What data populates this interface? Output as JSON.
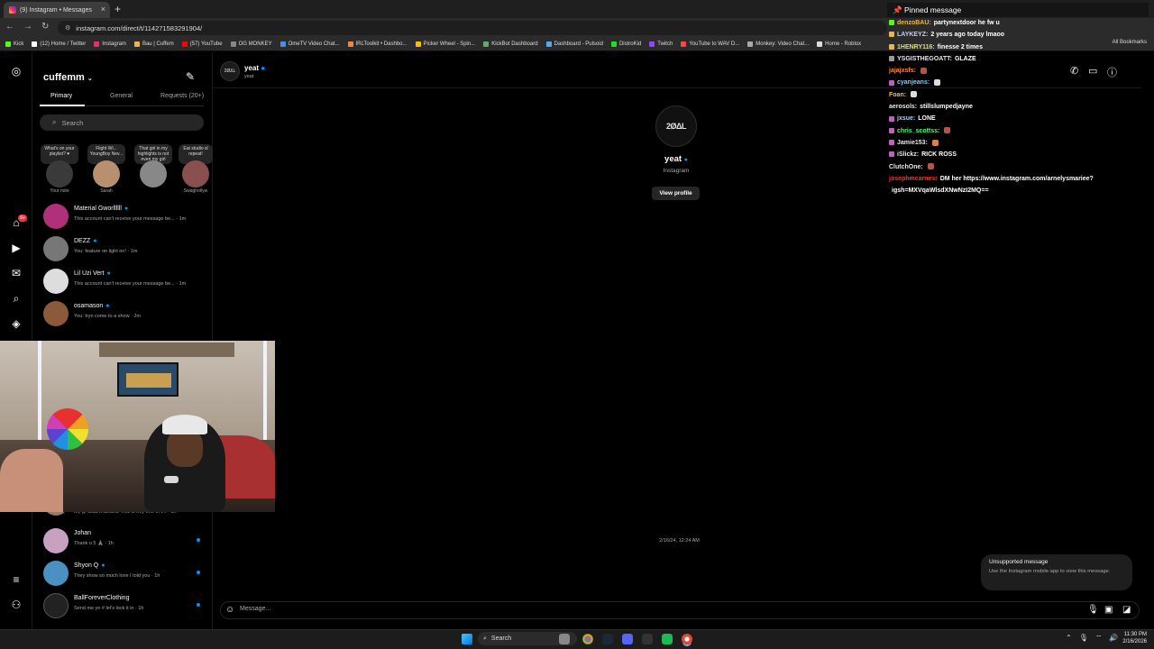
{
  "browser": {
    "tab_title": "(9) Instagram • Messages",
    "url": "instagram.com/direct/t/114271583291904/",
    "bookmarks": [
      "Kick",
      "(12) Home / Twitter",
      "Instagram",
      "Bau | Cuffem",
      "(57) YouTube",
      "OG MONKEY",
      "OmeTV Video Chat...",
      "IRLToolkit • Dashbo...",
      "Picker Wheel - Spin...",
      "KickBot Dashboard",
      "Dashboard - Pulsoid",
      "DistroKid",
      "Twitch",
      "YouTube to WAV D...",
      "Monkey: Video Chat...",
      "Home - Roblox"
    ],
    "all_bookmarks": "All Bookmarks"
  },
  "inbox": {
    "username": "cuffemm",
    "tabs": [
      "Primary",
      "General",
      "Requests (20+)"
    ],
    "search_placeholder": "Search",
    "notes": [
      {
        "bubble": "What's on your playlist? ♥",
        "name": "Your note"
      },
      {
        "bubble": "Flight Wi... YoungBoy Nev...",
        "name": "Sarah"
      },
      {
        "bubble": "That girl in my highlights is not even my girl",
        "name": ""
      },
      {
        "bubble": "Eat studio sl repeat!",
        "name": "Swaghollyw"
      }
    ],
    "conversations": [
      {
        "name": "Material Gworllllll",
        "verified": "●",
        "preview": "This account can't receive your message be... · 1m"
      },
      {
        "name": "DEZZ",
        "verified": "●",
        "preview": "You: feature on light on! · 1m"
      },
      {
        "name": "Lil Uzi Vert",
        "verified": "●",
        "preview": "This account can't receive your message be... · 1m"
      },
      {
        "name": "osamason",
        "verified": "●",
        "preview": "You: tryn come to a show · 2m"
      },
      {
        "name": "",
        "verified": "",
        "preview": "My g. Glad it landed. This is lrey one of t... · 1h"
      },
      {
        "name": "Johan",
        "verified": "",
        "preview": "Thank u 5 🙏🏽 · 1h"
      },
      {
        "name": "Shyon Q",
        "verified": "●",
        "preview": "They show so much love I told you · 1h"
      },
      {
        "name": "BallForeverClothing",
        "verified": "",
        "preview": "Send me yo # let's lock it in · 1h"
      }
    ],
    "notification_badge": "9+"
  },
  "chat": {
    "header_name": "yeat",
    "header_sub": "yeat",
    "avatar_text": "2ØΔL",
    "profile_name": "yeat",
    "profile_sub": "Instagram",
    "view_profile": "View profile",
    "timestamp": "2/16/24, 12:24 AM",
    "unsupported_title": "Unsupported message",
    "unsupported_desc": "Use the Instagram mobile app to view this message.",
    "message_placeholder": "Message..."
  },
  "stream_chat": {
    "pinned_label": "Pinned message",
    "messages": [
      {
        "user": "denzoBAU:",
        "text": "partynextdoor he fw u",
        "color": "#e9b64a"
      },
      {
        "user": "LAYKEYZ:",
        "text": "2 years ago today lmaoo",
        "color": "#c8c8ff"
      },
      {
        "user": "1HENRY116:",
        "text": "finesse 2 times",
        "color": "#e0e060"
      },
      {
        "user": "YSGISTHEGOATT:",
        "text": "GLAZE",
        "color": "#e8e8e8"
      },
      {
        "user": "jajajxsfs:",
        "text": "",
        "color": "#ff8c42"
      },
      {
        "user": "cyanjeans:",
        "text": "",
        "color": "#7ad1ff"
      },
      {
        "user": "Foan:",
        "text": "",
        "color": "#f0c060"
      },
      {
        "user": "aerosols:",
        "text": "stillslumpedjayne",
        "color": "#e8e8e8"
      },
      {
        "user": "jxsue:",
        "text": "LONE",
        "color": "#9ad6ff"
      },
      {
        "user": "chris_scottss:",
        "text": "",
        "color": "#4cff6a"
      },
      {
        "user": "Jamie153:",
        "text": "",
        "color": "#e8e8e8"
      },
      {
        "user": "iSlickz:",
        "text": "RICK ROSS",
        "color": "#e8e8e8"
      },
      {
        "user": "ClutchOne:",
        "text": "",
        "color": "#e8e8e8"
      },
      {
        "user": "josephmcarnes:",
        "text": "DM her https://www.instagram.com/arnelysmariee?",
        "color": "#ff3030"
      },
      {
        "user": "",
        "text": "igsh=MXVqaWlsdXNwNzI2MQ==",
        "color": "#e8e8e8"
      }
    ]
  },
  "taskbar": {
    "search_label": "Search",
    "time": "11:30 PM",
    "date": "2/16/2026"
  }
}
